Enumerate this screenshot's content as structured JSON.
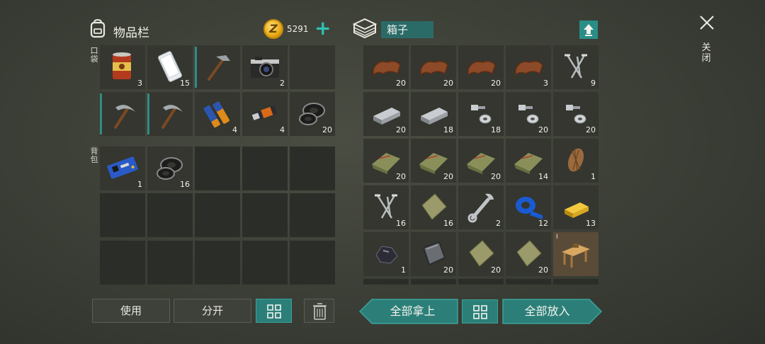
{
  "inventory": {
    "title": "物品栏",
    "coin_symbol": "Z",
    "coins": "5291",
    "add_label": "+",
    "pockets_label": "口袋",
    "backpack_label": "背包",
    "pockets": [
      {
        "name": "canned-food",
        "qty": "3"
      },
      {
        "name": "smartphone",
        "qty": "15"
      },
      {
        "name": "hammer",
        "qty": ""
      },
      {
        "name": "camera",
        "qty": "2"
      },
      {
        "name": "empty",
        "qty": ""
      },
      {
        "name": "pickaxe",
        "qty": ""
      },
      {
        "name": "pickaxe",
        "qty": ""
      },
      {
        "name": "batteries",
        "qty": "4"
      },
      {
        "name": "usb-stick",
        "qty": "4"
      },
      {
        "name": "washers",
        "qty": "20"
      }
    ],
    "backpack": [
      {
        "name": "circuit-board",
        "qty": "1"
      },
      {
        "name": "washers",
        "qty": "16"
      }
    ]
  },
  "box": {
    "title": "箱子",
    "close_label": "关闭",
    "items": [
      {
        "name": "leather",
        "qty": "20"
      },
      {
        "name": "leather",
        "qty": "20"
      },
      {
        "name": "leather",
        "qty": "20"
      },
      {
        "name": "leather",
        "qty": "3"
      },
      {
        "name": "nails",
        "qty": "9"
      },
      {
        "name": "metal-ingot",
        "qty": "20"
      },
      {
        "name": "metal-ingot",
        "qty": "18"
      },
      {
        "name": "bolts",
        "qty": "18"
      },
      {
        "name": "bolts",
        "qty": "20"
      },
      {
        "name": "bolts",
        "qty": "20"
      },
      {
        "name": "cloth",
        "qty": "20"
      },
      {
        "name": "cloth",
        "qty": "20"
      },
      {
        "name": "cloth",
        "qty": "20"
      },
      {
        "name": "cloth",
        "qty": "14"
      },
      {
        "name": "fiber",
        "qty": "1"
      },
      {
        "name": "nails",
        "qty": "16"
      },
      {
        "name": "burlap",
        "qty": "16"
      },
      {
        "name": "wrench",
        "qty": "2"
      },
      {
        "name": "blue-tape",
        "qty": "12"
      },
      {
        "name": "gold-bar",
        "qty": "13"
      },
      {
        "name": "coal",
        "qty": "1"
      },
      {
        "name": "steel-plate",
        "qty": "20"
      },
      {
        "name": "burlap",
        "qty": "20"
      },
      {
        "name": "burlap",
        "qty": "20"
      },
      {
        "name": "workbench",
        "qty": ""
      }
    ],
    "workbench_marker": "I"
  },
  "actions": {
    "use": "使用",
    "split": "分开",
    "take_all": "全部拿上",
    "put_all": "全部放入"
  },
  "colors": {
    "accent": "#2c7f79",
    "slot": "#2b2d28",
    "coin": "#e8a915"
  }
}
